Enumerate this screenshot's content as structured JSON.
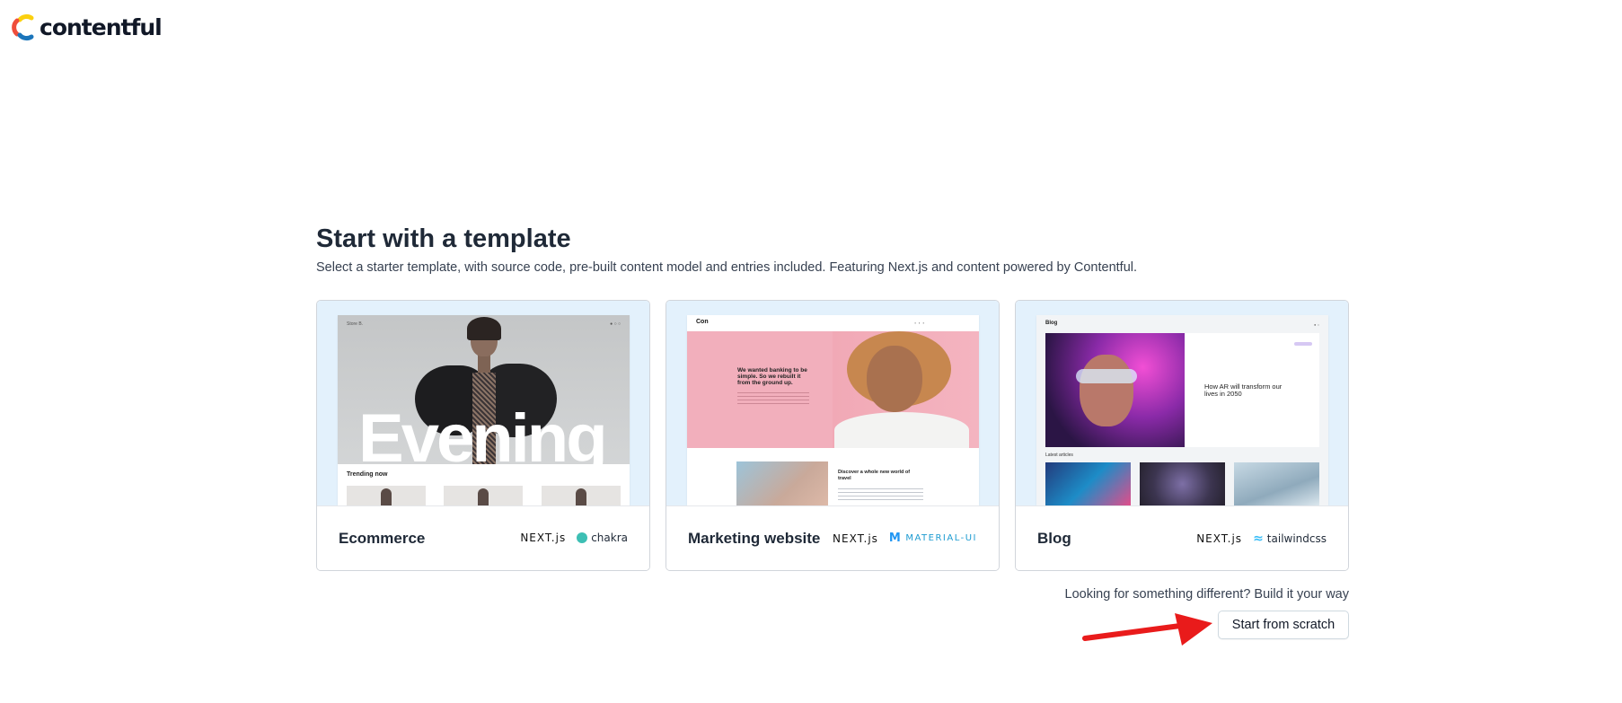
{
  "brand": {
    "name": "contentful"
  },
  "main": {
    "title": "Start with a template",
    "subtitle": "Select a starter template, with source code, pre-built content model and entries included. Featuring Next.js and content powered by Contentful."
  },
  "templates": [
    {
      "name": "Ecommerce",
      "logos": [
        "NEXT.js",
        "chakra"
      ],
      "preview": {
        "brand": "Store B.",
        "hero_word": "Evening",
        "section": "Trending now"
      }
    },
    {
      "name": "Marketing website",
      "logos": [
        "NEXT.js",
        "MATERIAL-UI"
      ],
      "preview": {
        "brand": "Con",
        "hero_heading": "We wanted banking to be simple. So we rebuilt it from the ground up.",
        "section_heading": "Discover a whole new world of travel"
      }
    },
    {
      "name": "Blog",
      "logos": [
        "NEXT.js",
        "tailwindcss"
      ],
      "preview": {
        "brand": "Blog",
        "featured_title": "How AR will transform our lives in 2050",
        "section": "Latest articles"
      }
    }
  ],
  "footer": {
    "prompt": "Looking for something different? Build it your way",
    "scratch_button": "Start from scratch"
  },
  "colors": {
    "accent_arrow": "#e91b1b",
    "preview_background": "#e3f1fc"
  }
}
